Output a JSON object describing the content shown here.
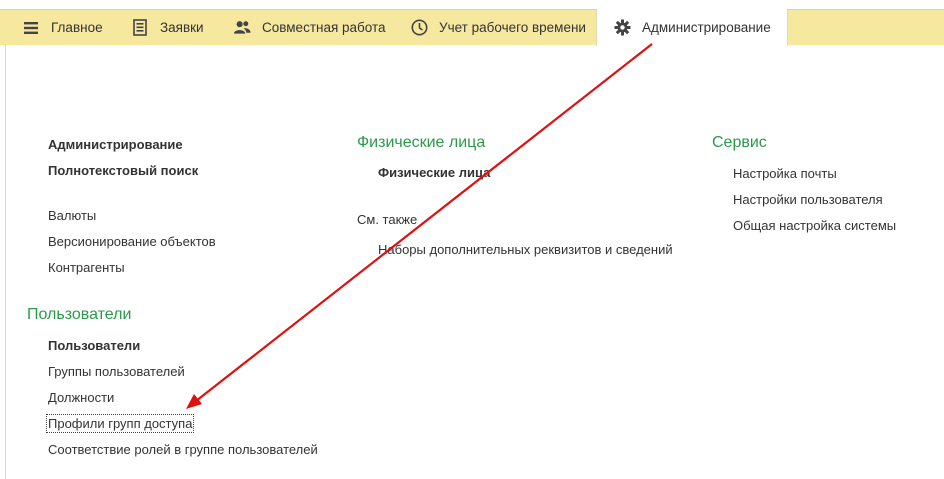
{
  "tabs": [
    {
      "label": "Главное",
      "icon": "menu-icon"
    },
    {
      "label": "Заявки",
      "icon": "document-icon"
    },
    {
      "label": "Совместная работа",
      "icon": "users-icon"
    },
    {
      "label": "Учет рабочего времени",
      "icon": "clock-icon"
    },
    {
      "label": "Администрирование",
      "icon": "gear-icon",
      "active": true
    }
  ],
  "left": {
    "admin": "Администрирование",
    "fulltext": "Полнотекстовый поиск",
    "currencies": "Валюты",
    "versioning": "Версионирование объектов",
    "counterparties": "Контрагенты",
    "users_header": "Пользователи",
    "users": "Пользователи",
    "user_groups": "Группы пользователей",
    "positions": "Должности",
    "access_profiles": "Профили групп доступа",
    "roles_mapping": "Соответствие ролей в группе пользователей"
  },
  "middle": {
    "header": "Физические лица",
    "persons": "Физические лица",
    "see_also": "См. также",
    "attribute_sets": "Наборы дополнительных реквизитов и сведений"
  },
  "right": {
    "header": "Сервис",
    "mail_settings": "Настройка почты",
    "user_settings": "Настройки пользователя",
    "system_settings": "Общая настройка системы"
  },
  "colors": {
    "tabbar": "#f7e8a0",
    "section_header": "#2a9a4b",
    "annotation_arrow": "#dd1111"
  }
}
